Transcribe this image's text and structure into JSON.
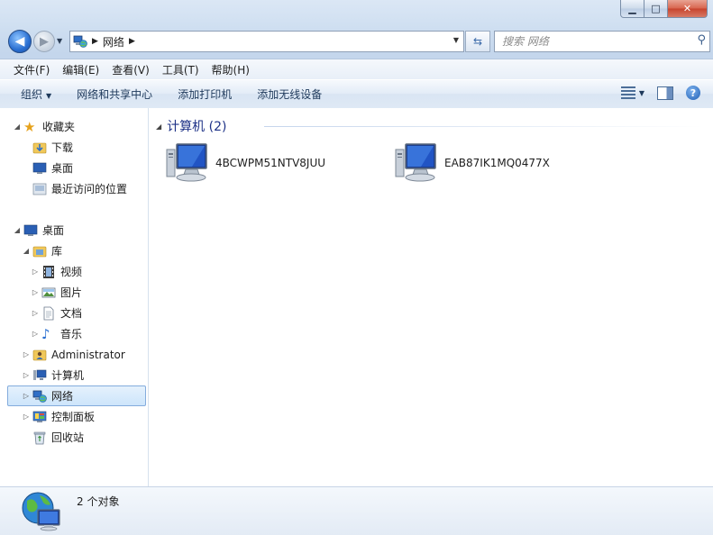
{
  "window": {
    "caption": {
      "minimize": "▁",
      "maximize": "□",
      "close": "✕"
    }
  },
  "nav": {
    "back_glyph": "◀",
    "forward_glyph": "▶",
    "breadcrumb": [
      "网络"
    ],
    "search_placeholder": "搜索 网络"
  },
  "menu": [
    "文件(F)",
    "编辑(E)",
    "查看(V)",
    "工具(T)",
    "帮助(H)"
  ],
  "commands": {
    "organize": "组织",
    "network_center": "网络和共享中心",
    "add_printer": "添加打印机",
    "add_wireless": "添加无线设备"
  },
  "tree": {
    "favorites": "收藏夹",
    "downloads": "下载",
    "desktop_fav": "桌面",
    "recent": "最近访问的位置",
    "desktop": "桌面",
    "libraries": "库",
    "videos": "视频",
    "pictures": "图片",
    "documents": "文档",
    "music": "音乐",
    "administrator": "Administrator",
    "computer": "计算机",
    "network": "网络",
    "control_panel": "控制面板",
    "recycle_bin": "回收站"
  },
  "content": {
    "group_label": "计算机 (2)",
    "items": [
      "4BCWPM51NTV8JUU",
      "EAB87IK1MQ0477X"
    ]
  },
  "details": {
    "count": "2 个对象"
  },
  "colors": {
    "selection_bg": "#cde5fb",
    "selection_border": "#84acdd",
    "group_header": "#1e3287",
    "command_text": "#1e395b"
  }
}
